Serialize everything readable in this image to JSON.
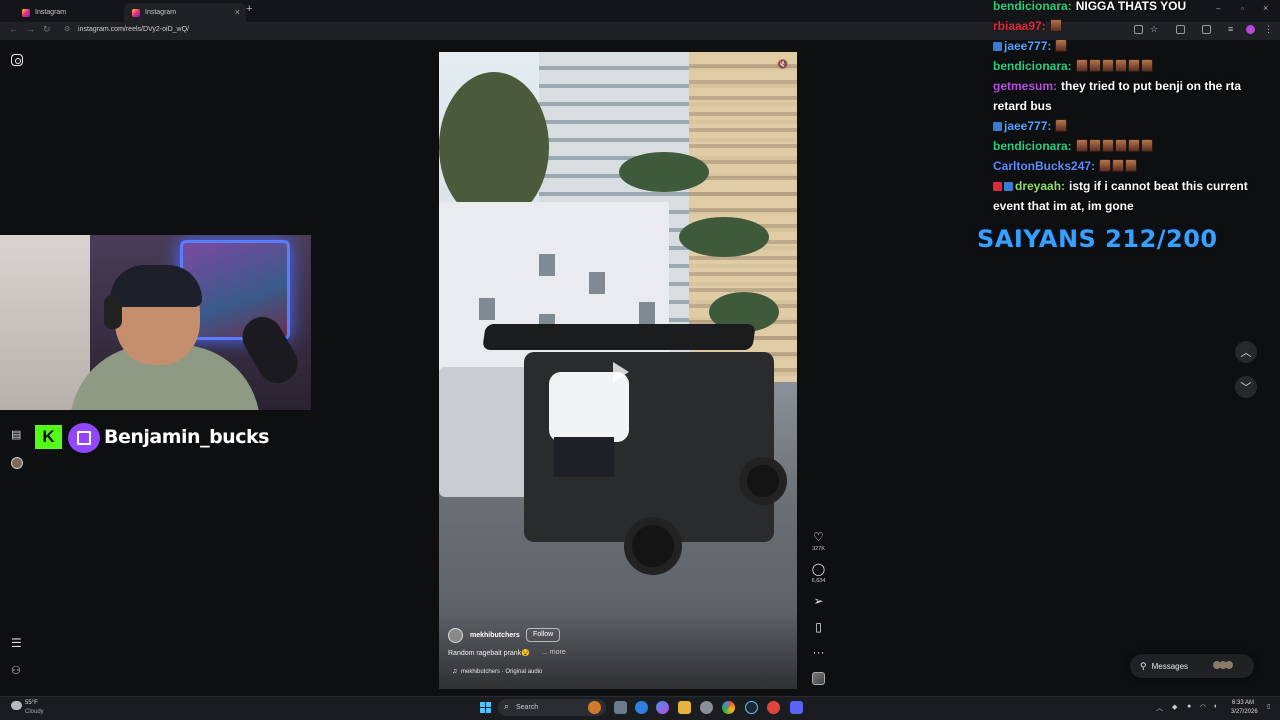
{
  "browser": {
    "tabs": [
      {
        "label": "Instagram"
      },
      {
        "label": "Instagram"
      }
    ],
    "url": "instagram.com/reels/DVy2-oiD_wQ/"
  },
  "stream": {
    "streamer_name": "Benjamin_bucks",
    "kick_letter": "K",
    "goal_text": "SAIYANS 212/200"
  },
  "chat": [
    {
      "user": "bendicionara:",
      "user_color": "#26d07c",
      "message": "NIGGA THATS YOU",
      "badge": "",
      "emotes": 0
    },
    {
      "user": "rbiaaa97:",
      "user_color": "#e0293f",
      "message": "",
      "badge": "",
      "emotes": 1
    },
    {
      "user": "jaee777:",
      "user_color": "#4fa3ff",
      "message": "",
      "badge": "blue",
      "emotes": 1
    },
    {
      "user": "bendicionara:",
      "user_color": "#26d07c",
      "message": "",
      "badge": "",
      "emotes": 6
    },
    {
      "user": "getmesum:",
      "user_color": "#b84de0",
      "message": "they tried to put benji on the rta retard bus",
      "badge": "",
      "emotes": 0
    },
    {
      "user": "jaee777:",
      "user_color": "#4fa3ff",
      "message": "",
      "badge": "blue",
      "emotes": 1
    },
    {
      "user": "bendicionara:",
      "user_color": "#26d07c",
      "message": "",
      "badge": "",
      "emotes": 6
    },
    {
      "user": "CarltonBucks247:",
      "user_color": "#5c8dff",
      "message": "",
      "badge": "",
      "emotes": 3
    },
    {
      "user": "dreyaah:",
      "user_color": "#8fe06a",
      "message": "istg if i cannot beat this current event that im at, im gone",
      "badge": "red-blue",
      "emotes": 0
    }
  ],
  "reel": {
    "username": "mekhibutchers",
    "follow_label": "Follow",
    "caption": "Random ragebait prank😵",
    "more_label": "... more",
    "audio": "mekhibutchers · Original audio",
    "likes": "327K",
    "comments": "6,634"
  },
  "messages_label": "Messages",
  "taskbar": {
    "weather_temp": "55°F",
    "weather_desc": "Cloudy",
    "search_placeholder": "Search",
    "time": "6:33 AM",
    "date": "3/27/2026"
  },
  "colors": {
    "kick_green": "#53fc18",
    "twitch_purple": "#9146ff",
    "goal_blue": "#3aa0ff"
  }
}
